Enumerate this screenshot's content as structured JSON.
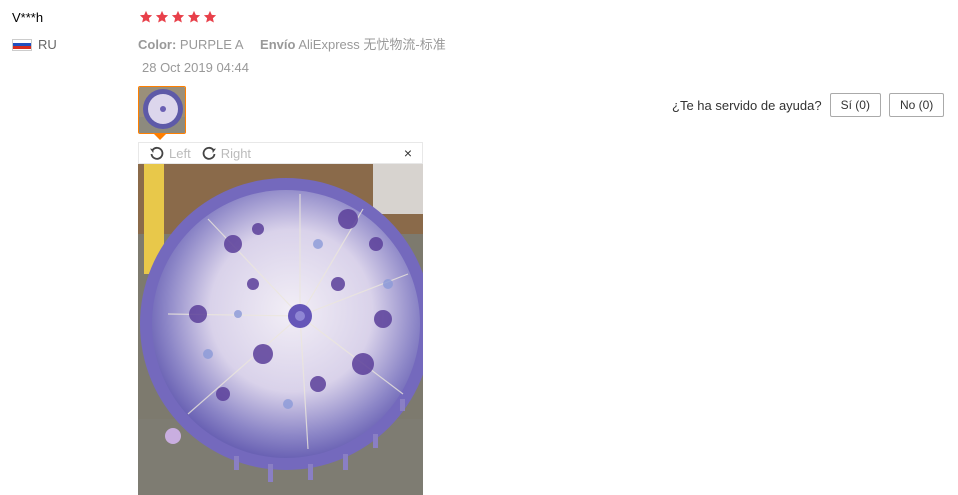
{
  "review": {
    "user": "V***h",
    "country": "RU",
    "rating_stars": 5,
    "color_label": "Color:",
    "color_value": "PURPLE A",
    "shipping_label": "Envío",
    "shipping_value": "AliExpress 无忧物流-标准",
    "date": "28 Oct 2019 04:44"
  },
  "helpful": {
    "question": "¿Te ha servido de ayuda?",
    "yes_label": "Sí (0)",
    "no_label": "No (0)"
  },
  "viewer": {
    "rotate_left": "Left",
    "rotate_right": "Right",
    "close": "×"
  },
  "colors": {
    "star": "#e8404a",
    "thumb_border": "#ff7f00",
    "muted_text": "#999999"
  },
  "icons": [
    "star-icon",
    "russia-flag-icon",
    "rotate-left-icon",
    "rotate-right-icon",
    "close-icon"
  ]
}
